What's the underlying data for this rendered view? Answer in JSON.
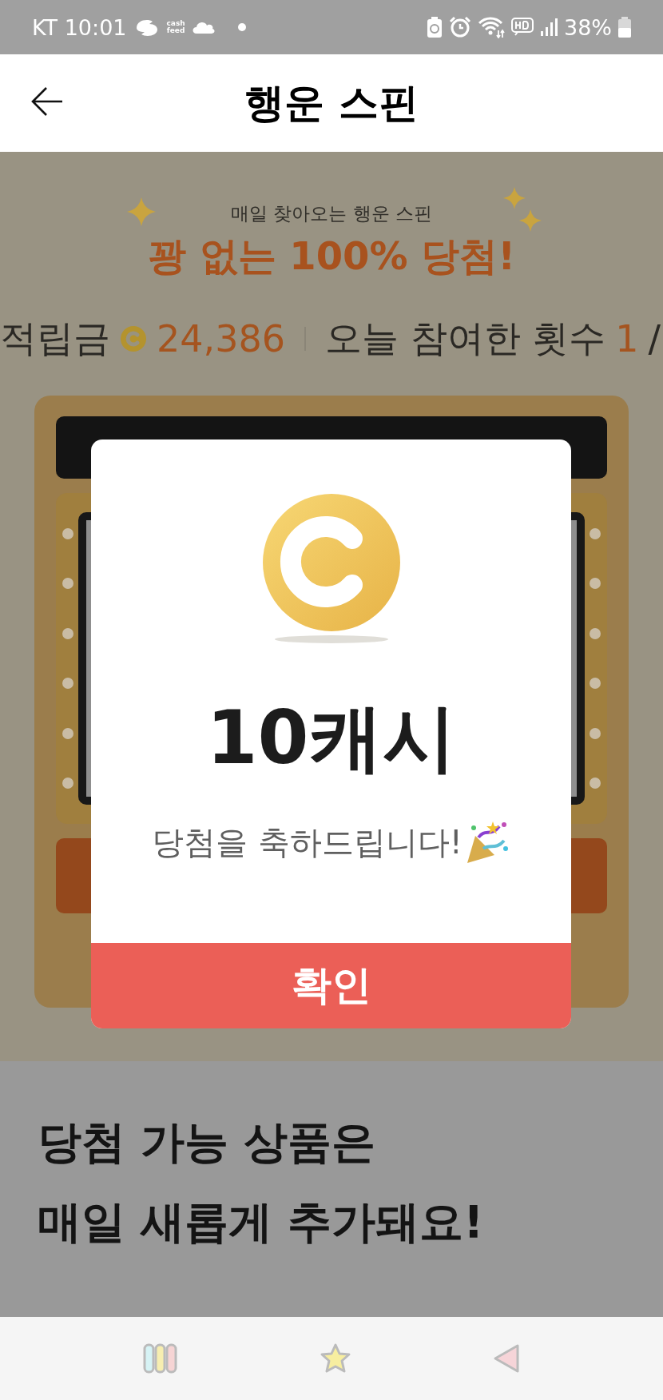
{
  "status_bar": {
    "carrier_time": "KT 10:01",
    "app_badge": [
      "cash",
      "feed"
    ],
    "battery": "38%"
  },
  "header": {
    "title": "행운 스핀"
  },
  "promo": {
    "subtitle": "매일 찾아오는 행운 스핀",
    "headline": "꽝 없는 100% 당첨!"
  },
  "stats": {
    "points_label": "적립금",
    "points": "24,386",
    "count_label": "오늘 참여한 횟수",
    "count": "1",
    "separator": "/"
  },
  "dialog": {
    "amount": "10캐시",
    "message": "당첨을 축하드립니다!",
    "confirm": "확인"
  },
  "prizes": {
    "heading": [
      "당첨 가능 상품은",
      "매일 새롭게 추가돼요!"
    ]
  }
}
